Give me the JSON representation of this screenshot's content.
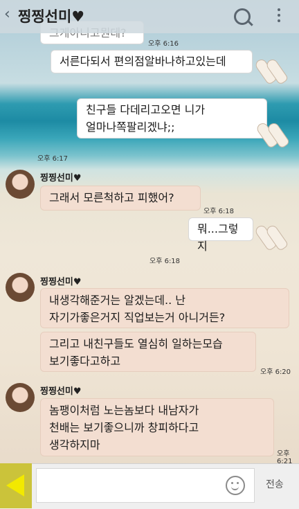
{
  "header": {
    "back_icon": "chevron-left-icon",
    "title": "찡찡선미♥",
    "search_icon": "search-icon",
    "menu_icon": "more-vertical-icon"
  },
  "messages": [
    {
      "type": "sent",
      "text": "서른다되서 편의점알바나하고있는데",
      "time": "오후 6:16"
    },
    {
      "type": "sent",
      "text": "친구들 다데리고오면 니가\n얼마나쪽팔리겠냐;;",
      "time": "오후 6:17"
    },
    {
      "type": "received",
      "name": "찡찡선미♥",
      "text": "그래서 모른척하고 피했어?",
      "time": "오후 6:18"
    },
    {
      "type": "sent",
      "text": "뭐...그렇지",
      "time": "오후 6:18"
    },
    {
      "type": "received",
      "name": "찡찡선미♥",
      "text": "내생각해준거는 알겠는데.. 난\n자기가좋은거지 직업보는거 아니거든?"
    },
    {
      "type": "received",
      "text": "그리고 내친구들도 열심히 일하는모습\n보기좋다고하고",
      "time": "오후 6:20"
    },
    {
      "type": "received",
      "name": "찡찡선미♥",
      "text": "놈팽이처럼 노는놈보다 내남자가\n천배는 보기좋으니까  창피하다고\n생각하지마",
      "time": "오후 6:21"
    }
  ],
  "partial_top": "그게아니고뭔데?",
  "input": {
    "send_label": "전송",
    "emoji_icon": "smiley-icon",
    "attach_icon": "send-arrow-icon"
  }
}
